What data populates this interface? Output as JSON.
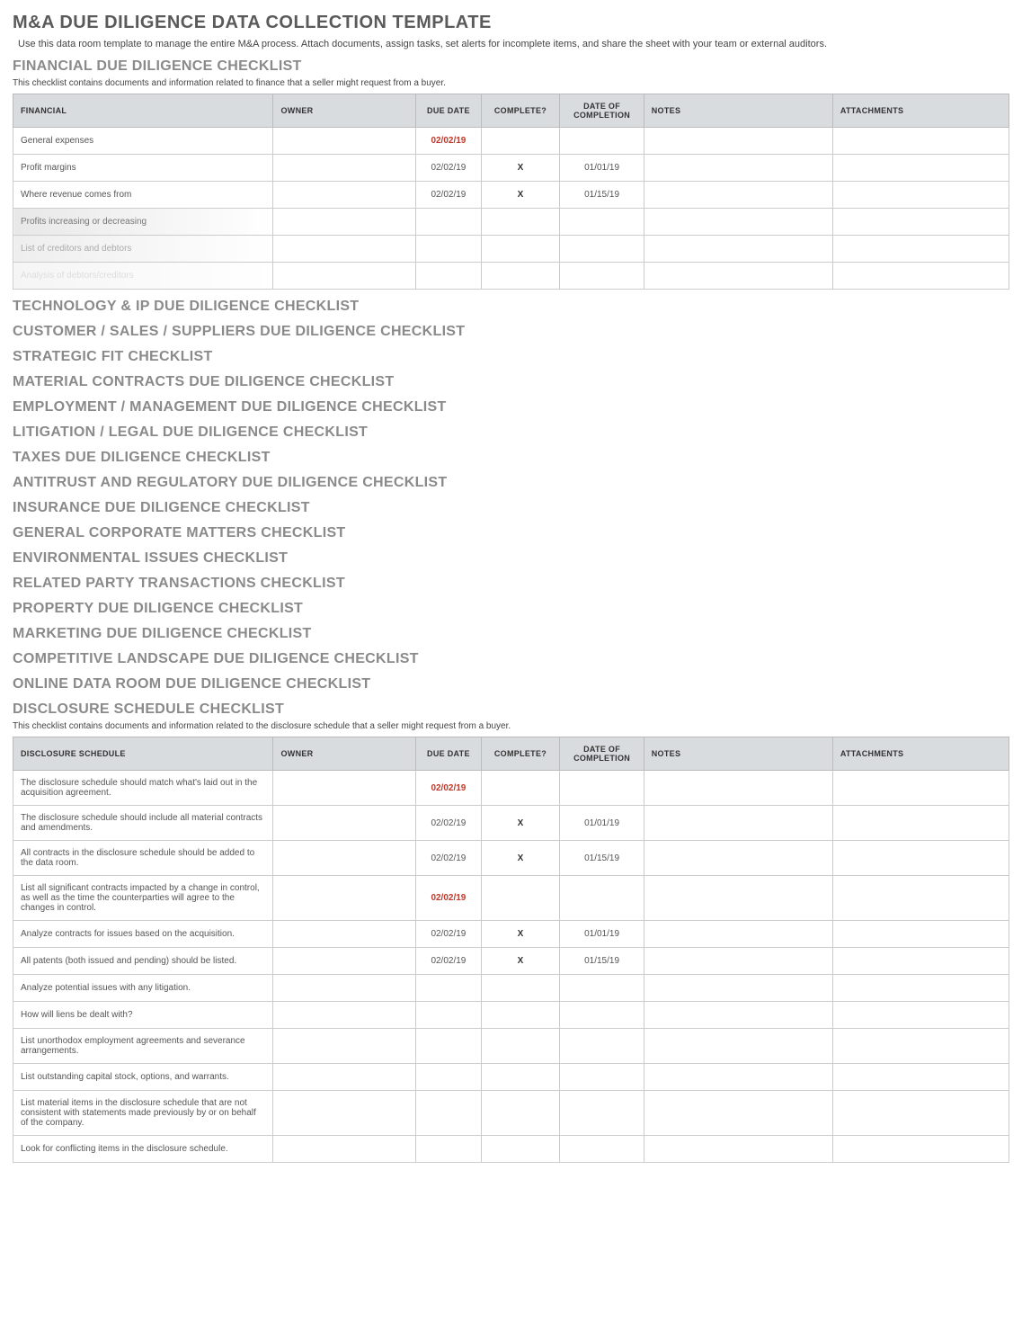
{
  "page": {
    "title": "M&A DUE DILIGENCE DATA COLLECTION TEMPLATE",
    "subtitle": "Use this data room template to manage the entire M&A process. Attach documents, assign tasks, set alerts for incomplete items, and share the sheet with your team or external auditors."
  },
  "columns": {
    "owner": "OWNER",
    "due_date": "DUE DATE",
    "complete": "COMPLETE?",
    "date_of_completion": "DATE OF COMPLETION",
    "notes": "NOTES",
    "attachments": "ATTACHMENTS"
  },
  "financial": {
    "heading": "FINANCIAL DUE DILIGENCE CHECKLIST",
    "desc": "This checklist contains documents and information related to finance that a seller might request from a buyer.",
    "col_label": "FINANCIAL",
    "rows": [
      {
        "item": "General expenses",
        "owner": "",
        "due_date": "02/02/19",
        "overdue": true,
        "complete": "",
        "completion_date": "",
        "notes": "",
        "attachments": ""
      },
      {
        "item": "Profit margins",
        "owner": "",
        "due_date": "02/02/19",
        "overdue": false,
        "complete": "X",
        "completion_date": "01/01/19",
        "notes": "",
        "attachments": ""
      },
      {
        "item": "Where revenue comes from",
        "owner": "",
        "due_date": "02/02/19",
        "overdue": false,
        "complete": "X",
        "completion_date": "01/15/19",
        "notes": "",
        "attachments": ""
      },
      {
        "item": "Profits increasing or decreasing",
        "owner": "",
        "due_date": "",
        "overdue": false,
        "complete": "",
        "completion_date": "",
        "notes": "",
        "attachments": "",
        "fade": 1
      },
      {
        "item": "List of creditors and debtors",
        "owner": "",
        "due_date": "",
        "overdue": false,
        "complete": "",
        "completion_date": "",
        "notes": "",
        "attachments": "",
        "fade": 2
      },
      {
        "item": "Analysis of debtors/creditors",
        "owner": "",
        "due_date": "",
        "overdue": false,
        "complete": "",
        "completion_date": "",
        "notes": "",
        "attachments": "",
        "fade": 3
      }
    ]
  },
  "section_headings": [
    "TECHNOLOGY & IP DUE DILIGENCE CHECKLIST",
    "CUSTOMER / SALES / SUPPLIERS DUE DILIGENCE CHECKLIST",
    "STRATEGIC FIT CHECKLIST",
    "MATERIAL CONTRACTS DUE DILIGENCE CHECKLIST",
    "EMPLOYMENT / MANAGEMENT DUE DILIGENCE CHECKLIST",
    "LITIGATION / LEGAL DUE DILIGENCE CHECKLIST",
    "TAXES DUE DILIGENCE CHECKLIST",
    "ANTITRUST AND REGULATORY DUE DILIGENCE CHECKLIST",
    "INSURANCE DUE DILIGENCE CHECKLIST",
    "GENERAL CORPORATE MATTERS CHECKLIST",
    "ENVIRONMENTAL ISSUES CHECKLIST",
    "RELATED PARTY TRANSACTIONS CHECKLIST",
    "PROPERTY DUE DILIGENCE CHECKLIST",
    "MARKETING DUE DILIGENCE CHECKLIST",
    "COMPETITIVE LANDSCAPE DUE DILIGENCE CHECKLIST",
    "ONLINE DATA ROOM DUE DILIGENCE CHECKLIST"
  ],
  "disclosure": {
    "heading": "DISCLOSURE SCHEDULE CHECKLIST",
    "desc": "This checklist contains documents and information related to the disclosure schedule that a seller might request from a buyer.",
    "col_label": "DISCLOSURE SCHEDULE",
    "rows": [
      {
        "item": "The disclosure schedule should match what's laid out in the acquisition agreement.",
        "owner": "",
        "due_date": "02/02/19",
        "overdue": true,
        "complete": "",
        "completion_date": "",
        "notes": "",
        "attachments": ""
      },
      {
        "item": "The disclosure schedule should include all material contracts and amendments.",
        "owner": "",
        "due_date": "02/02/19",
        "overdue": false,
        "complete": "X",
        "completion_date": "01/01/19",
        "notes": "",
        "attachments": ""
      },
      {
        "item": "All contracts in the disclosure schedule should be added to the data room.",
        "owner": "",
        "due_date": "02/02/19",
        "overdue": false,
        "complete": "X",
        "completion_date": "01/15/19",
        "notes": "",
        "attachments": ""
      },
      {
        "item": "List all significant contracts impacted by a change in control, as well as the time the counterparties will agree to the changes in control.",
        "owner": "",
        "due_date": "02/02/19",
        "overdue": true,
        "complete": "",
        "completion_date": "",
        "notes": "",
        "attachments": ""
      },
      {
        "item": "Analyze contracts for issues based on the acquisition.",
        "owner": "",
        "due_date": "02/02/19",
        "overdue": false,
        "complete": "X",
        "completion_date": "01/01/19",
        "notes": "",
        "attachments": ""
      },
      {
        "item": "All patents (both issued and pending) should be listed.",
        "owner": "",
        "due_date": "02/02/19",
        "overdue": false,
        "complete": "X",
        "completion_date": "01/15/19",
        "notes": "",
        "attachments": ""
      },
      {
        "item": "Analyze potential issues with any litigation.",
        "owner": "",
        "due_date": "",
        "overdue": false,
        "complete": "",
        "completion_date": "",
        "notes": "",
        "attachments": ""
      },
      {
        "item": "How will liens be dealt with?",
        "owner": "",
        "due_date": "",
        "overdue": false,
        "complete": "",
        "completion_date": "",
        "notes": "",
        "attachments": ""
      },
      {
        "item": "List unorthodox employment agreements and severance arrangements.",
        "owner": "",
        "due_date": "",
        "overdue": false,
        "complete": "",
        "completion_date": "",
        "notes": "",
        "attachments": ""
      },
      {
        "item": "List outstanding capital stock, options, and warrants.",
        "owner": "",
        "due_date": "",
        "overdue": false,
        "complete": "",
        "completion_date": "",
        "notes": "",
        "attachments": ""
      },
      {
        "item": "List material items in the disclosure schedule that are not consistent with statements made previously by or on behalf of the company.",
        "owner": "",
        "due_date": "",
        "overdue": false,
        "complete": "",
        "completion_date": "",
        "notes": "",
        "attachments": ""
      },
      {
        "item": "Look for conflicting items in the disclosure schedule.",
        "owner": "",
        "due_date": "",
        "overdue": false,
        "complete": "",
        "completion_date": "",
        "notes": "",
        "attachments": ""
      }
    ]
  }
}
